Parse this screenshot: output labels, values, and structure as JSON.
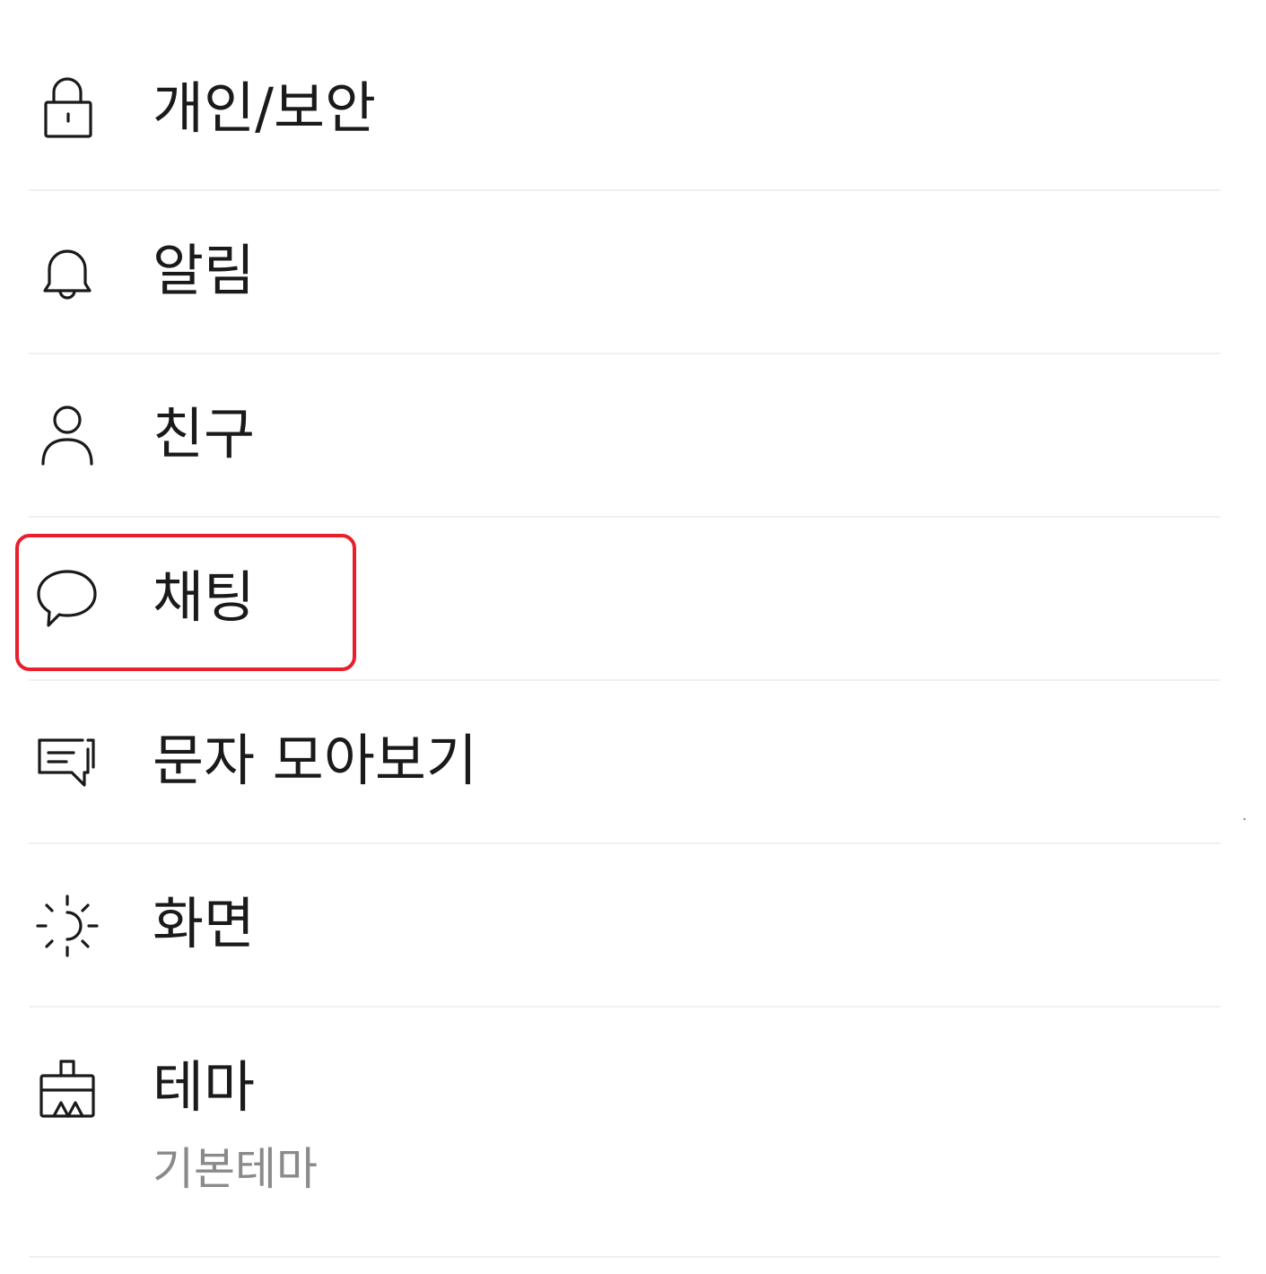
{
  "settings": {
    "items": [
      {
        "label": "개인/보안",
        "icon": "lock-icon"
      },
      {
        "label": "알림",
        "icon": "bell-icon"
      },
      {
        "label": "친구",
        "icon": "person-icon"
      },
      {
        "label": "채팅",
        "icon": "chat-bubble-icon"
      },
      {
        "label": "문자 모아보기",
        "icon": "sms-icon"
      },
      {
        "label": "화면",
        "icon": "brightness-icon"
      },
      {
        "label": "테마",
        "icon": "paint-brush-icon",
        "sublabel": "기본테마"
      }
    ]
  },
  "colors": {
    "highlight": "#e8202a",
    "text": "#1a1a1a",
    "subtext": "#8a8a8a",
    "divider": "#f0f0f0"
  }
}
